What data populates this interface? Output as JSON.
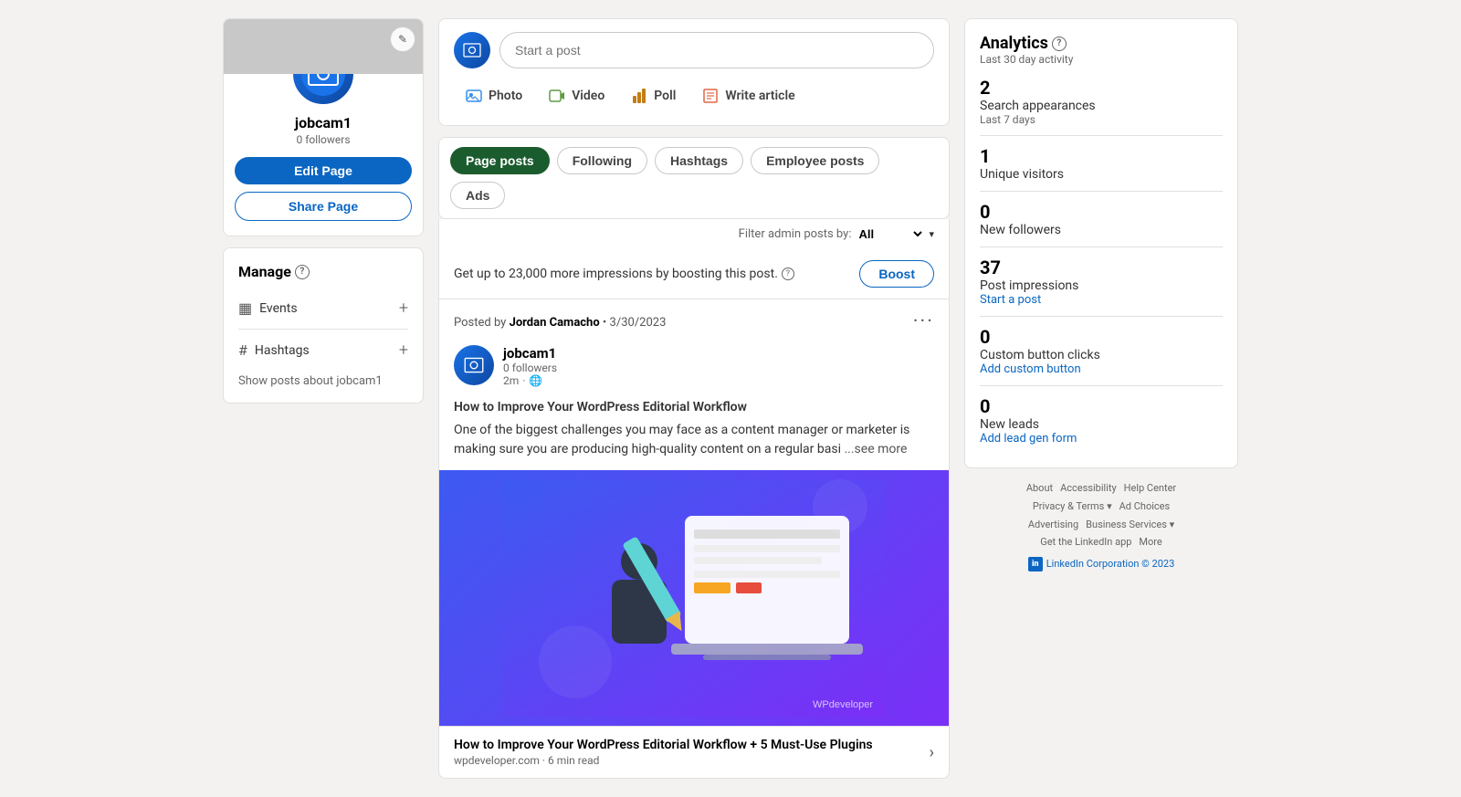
{
  "profile": {
    "name": "jobcam1",
    "followers": "0 followers",
    "edit_label": "Edit Page",
    "share_label": "Share Page"
  },
  "manage": {
    "title": "Manage",
    "events_label": "Events",
    "hashtags_label": "Hashtags",
    "show_posts_label": "Show posts about jobcam1"
  },
  "composer": {
    "placeholder": "Start a post",
    "action_photo": "Photo",
    "action_video": "Video",
    "action_poll": "Poll",
    "action_article": "Write article"
  },
  "tabs": {
    "page_posts": "Page posts",
    "following": "Following",
    "hashtags": "Hashtags",
    "employee_posts": "Employee posts",
    "ads": "Ads"
  },
  "filter": {
    "label": "Filter admin posts by:",
    "value": "All"
  },
  "boost_banner": {
    "text": "Get up to 23,000 more impressions by boosting this post.",
    "button": "Boost"
  },
  "post": {
    "posted_by": "Posted by",
    "author": "Jordan Camacho",
    "date": "3/30/2023",
    "page_name": "jobcam1",
    "page_followers": "0 followers",
    "time_ago": "2m",
    "title": "How to Improve Your WordPress Editorial Workflow",
    "body": "One of the biggest challenges you may face as a content manager or marketer is making sure you are producing high-quality content on a regular basi",
    "see_more": "...see more",
    "link_title": "How to Improve Your WordPress Editorial Workflow + 5 Must-Use Plugins",
    "link_source": "wpdeveloper.com · 6 min read"
  },
  "analytics": {
    "title": "Analytics",
    "help_icon": "?",
    "subtitle": "Last 30 day activity",
    "search_appearances_number": "2",
    "search_appearances_label": "Search appearances",
    "search_appearances_sub": "Last 7 days",
    "unique_visitors_number": "1",
    "unique_visitors_label": "Unique visitors",
    "new_followers_number": "0",
    "new_followers_label": "New followers",
    "post_impressions_number": "37",
    "post_impressions_label": "Post impressions",
    "post_impressions_link": "Start a post",
    "custom_clicks_number": "0",
    "custom_clicks_label": "Custom button clicks",
    "custom_clicks_link": "Add custom button",
    "new_leads_number": "0",
    "new_leads_label": "New leads",
    "new_leads_link": "Add lead gen form"
  },
  "footer": {
    "links": [
      "About",
      "Accessibility",
      "Help Center",
      "Privacy & Terms",
      "Ad Choices",
      "Advertising",
      "Business Services",
      "Get the LinkedIn app",
      "More"
    ],
    "copyright": "LinkedIn Corporation © 2023"
  }
}
